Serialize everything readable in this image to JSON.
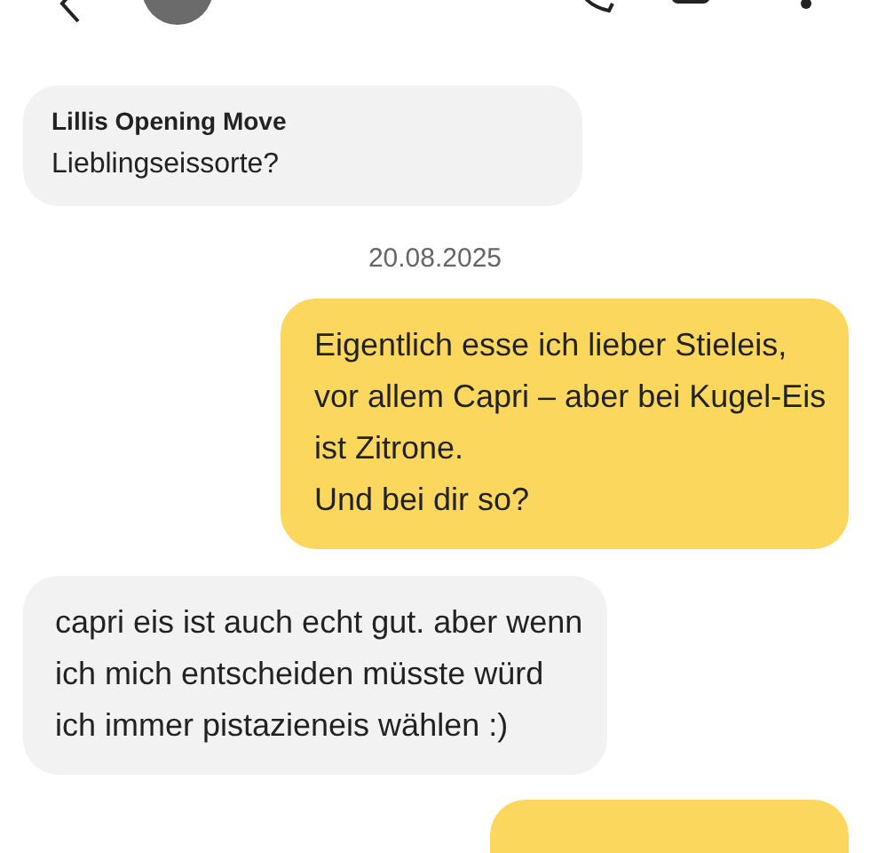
{
  "messages": [
    {
      "kind": "opening",
      "title": "Lillis Opening Move",
      "text": "Lieblingseissorte?"
    },
    {
      "kind": "date",
      "text": "20.08.2025"
    },
    {
      "kind": "outgoing",
      "text": "Eigentlich esse ich lieber Stieleis, vor allem Capri – aber bei Kugel-Eis ist Zitrone.\nUnd bei dir so?"
    },
    {
      "kind": "incoming",
      "text": "capri eis ist auch echt gut. aber wenn ich mich entscheiden müsste würd ich immer pistazieneis wählen :)"
    },
    {
      "kind": "outgoing-cut"
    }
  ]
}
